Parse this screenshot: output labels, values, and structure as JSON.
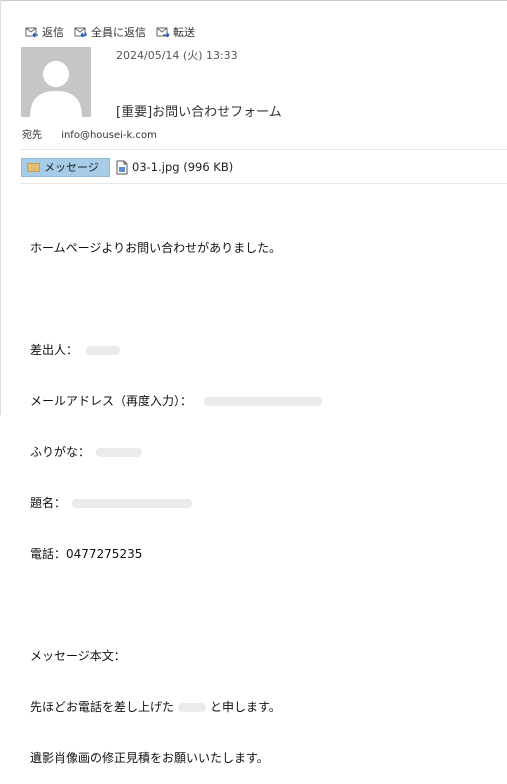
{
  "toolbar": {
    "reply": "返信",
    "reply_all": "全員に返信",
    "forward": "転送"
  },
  "message": {
    "date": "2024/05/14 (火) 13:33",
    "subject": "[重要]お問い合わせフォーム",
    "to_label": "宛先",
    "to_value": "info@housei-k.com"
  },
  "attachments": {
    "message_tab": "メッセージ",
    "file_label": "03-1.jpg (996 KB)"
  },
  "body": {
    "line1": "ホームページよりお問い合わせがありました。",
    "sender_label": "差出人：",
    "email_label": "メールアドレス（再度入力）：",
    "furigana_label": "ふりがな：",
    "title_label": "題名：",
    "phone_line": "電話：0477275235",
    "message_label": "メッセージ本文：",
    "msg_line1a": "先ほどお電話を差し上げた",
    "msg_line1b": "と申します。",
    "msg_line2": "遺影肖像画の修正見積をお願いいたします。"
  }
}
